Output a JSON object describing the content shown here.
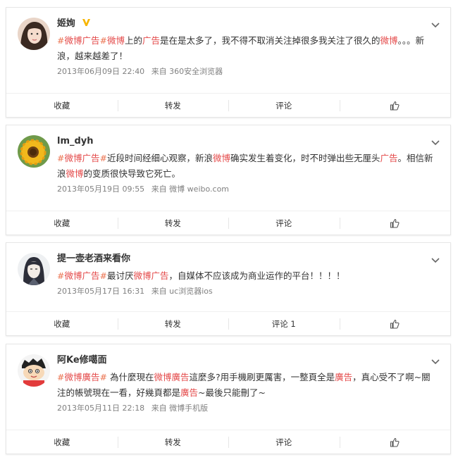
{
  "actions": {
    "favorite": "收藏",
    "repost": "转发",
    "comment": "评论",
    "like_icon": "thumbs-up-icon"
  },
  "posts": [
    {
      "username": "姬姰",
      "verified": true,
      "segments": [
        {
          "t": "#",
          "c": "topic"
        },
        {
          "t": "微博广告",
          "c": "kw"
        },
        {
          "t": "#",
          "c": "topic"
        },
        {
          "t": "微博",
          "c": "kw"
        },
        {
          "t": "上的"
        },
        {
          "t": "广告",
          "c": "kw"
        },
        {
          "t": "是在是太多了，我不得不取消关注掉很多我关注了很久的"
        },
        {
          "t": "微博",
          "c": "kw"
        },
        {
          "t": "。。。新浪，越来越差了！"
        }
      ],
      "time": "2013年06月09日 22:40",
      "source": "来自 360安全浏览器",
      "comment_label": "评论"
    },
    {
      "username": "lm_dyh",
      "verified": false,
      "segments": [
        {
          "t": "#",
          "c": "topic"
        },
        {
          "t": "微博广告",
          "c": "kw"
        },
        {
          "t": "#",
          "c": "topic"
        },
        {
          "t": "近段时间经细心观察，新浪"
        },
        {
          "t": "微博",
          "c": "kw"
        },
        {
          "t": "确实发生着变化，时不时弹出些无厘头"
        },
        {
          "t": "广告",
          "c": "kw"
        },
        {
          "t": "。相信新浪"
        },
        {
          "t": "微博",
          "c": "kw"
        },
        {
          "t": "的变质很快导致它死亡。"
        }
      ],
      "time": "2013年05月19日 09:55",
      "source": "来自 微博 weibo.com",
      "comment_label": "评论"
    },
    {
      "username": "提一壶老酒来看你",
      "verified": false,
      "segments": [
        {
          "t": "#",
          "c": "topic"
        },
        {
          "t": "微博广告",
          "c": "kw"
        },
        {
          "t": "#",
          "c": "topic"
        },
        {
          "t": "最讨厌"
        },
        {
          "t": "微博广告",
          "c": "kw"
        },
        {
          "t": "，自媒体不应该成为商业运作的平台！！！！"
        }
      ],
      "time": "2013年05月17日 16:31",
      "source": "来自 uc浏览器ios",
      "comment_label": "评论 1"
    },
    {
      "username": "阿Ke修噶面",
      "verified": false,
      "segments": [
        {
          "t": "#",
          "c": "topic"
        },
        {
          "t": "微博廣告",
          "c": "kw"
        },
        {
          "t": "#",
          "c": "topic"
        },
        {
          "t": " 為什麼現在"
        },
        {
          "t": "微博廣告",
          "c": "kw"
        },
        {
          "t": "這麼多?用手機刷更厲害，一整頁全是"
        },
        {
          "t": "廣告",
          "c": "kw"
        },
        {
          "t": "，真心受不了啊~關注的帳號現在一看，好幾頁都是"
        },
        {
          "t": "廣告",
          "c": "kw"
        },
        {
          "t": "~最後只能刪了~"
        }
      ],
      "time": "2013年05月11日 22:18",
      "source": "来自 微博手机版",
      "comment_label": "评论"
    }
  ]
}
